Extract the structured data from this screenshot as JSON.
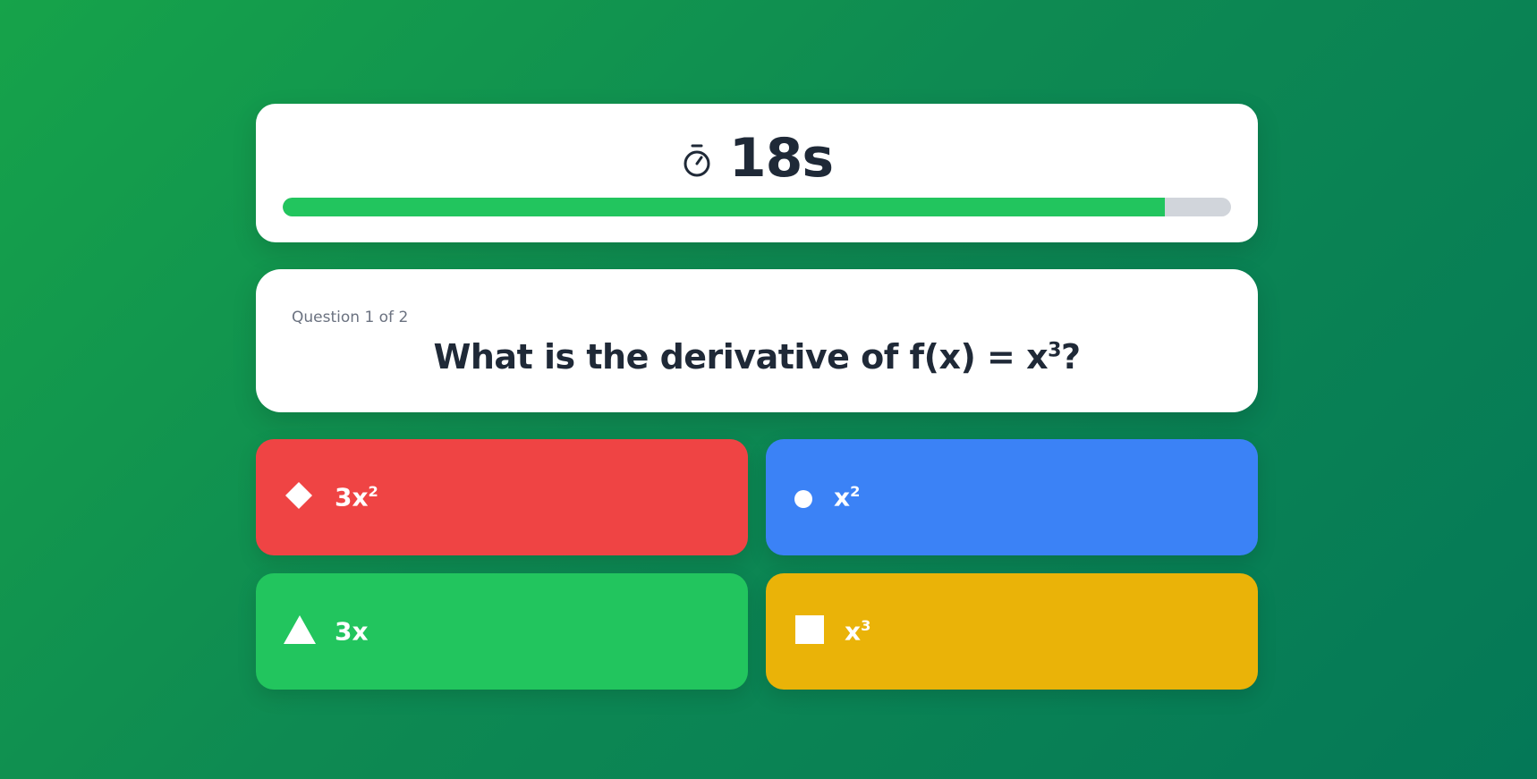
{
  "timer": {
    "icon": "stopwatch-icon",
    "seconds_label": "18s",
    "progress_fraction": 0.93
  },
  "question": {
    "counter": "Question 1 of 2",
    "text_main": "What is the derivative of f(x) = x",
    "text_sup": "3",
    "text_end": "?"
  },
  "answers": [
    {
      "shape": "diamond-icon",
      "base": "3x",
      "sup": "2",
      "color": "#ef4444"
    },
    {
      "shape": "circle-icon",
      "base": "x",
      "sup": "2",
      "color": "#3b82f6"
    },
    {
      "shape": "triangle-icon",
      "base": "3x",
      "sup": "",
      "color": "#22c55e"
    },
    {
      "shape": "square-icon",
      "base": "x",
      "sup": "3",
      "color": "#eab308"
    }
  ],
  "colors": {
    "background_start": "#16a34a",
    "background_end": "#047857",
    "progress_fill": "#22c55e",
    "progress_track": "#d1d5db",
    "text_dark": "#1f2937"
  }
}
